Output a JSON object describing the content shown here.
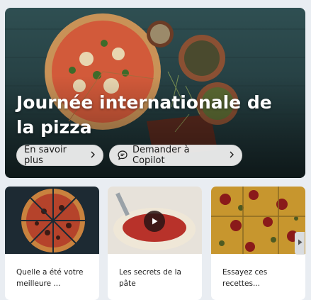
{
  "hero": {
    "title": "Journée internationale de la pizza",
    "learn_more_label": "En savoir plus",
    "copilot_label": "Demander à Copilot"
  },
  "cards": [
    {
      "caption": "Quelle a été votre meilleure ..."
    },
    {
      "caption": "Les secrets de la pâte"
    },
    {
      "caption": "Essayez ces recettes..."
    }
  ],
  "icons": {
    "chevron": "chevron-right-icon",
    "copilot": "chat-bubble-icon",
    "play": "play-icon",
    "next": "next-arrow-icon"
  }
}
